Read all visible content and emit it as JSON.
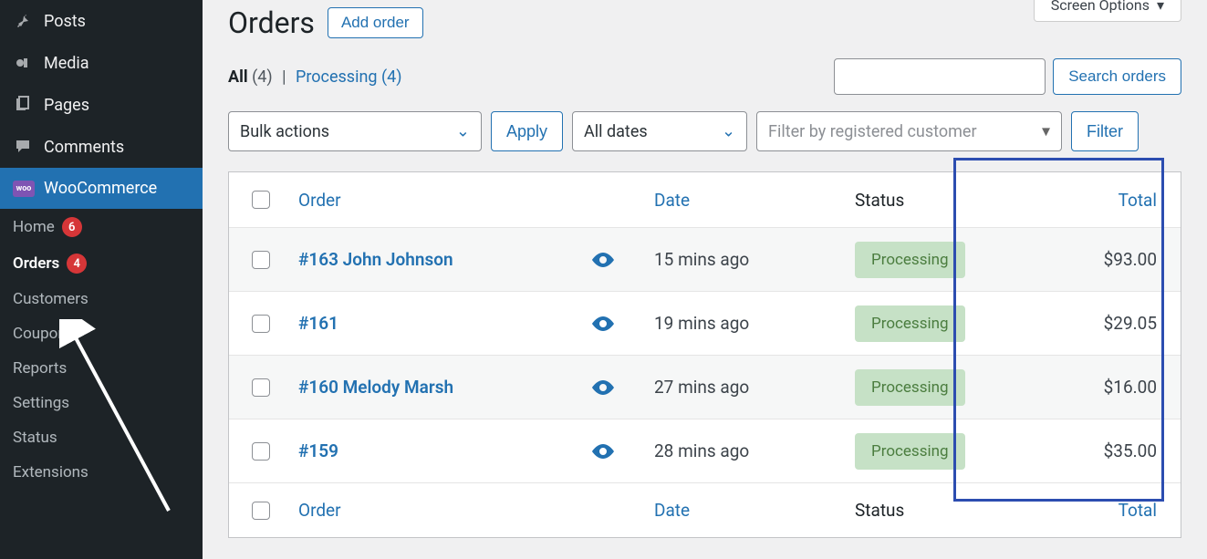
{
  "screen_options_label": "Screen Options",
  "sidebar": {
    "items": [
      {
        "label": "Posts"
      },
      {
        "label": "Media"
      },
      {
        "label": "Pages"
      },
      {
        "label": "Comments"
      },
      {
        "label": "WooCommerce"
      }
    ],
    "subs": [
      {
        "label": "Home",
        "badge": "6"
      },
      {
        "label": "Orders",
        "badge": "4"
      },
      {
        "label": "Customers"
      },
      {
        "label": "Coupons"
      },
      {
        "label": "Reports"
      },
      {
        "label": "Settings"
      },
      {
        "label": "Status"
      },
      {
        "label": "Extensions"
      }
    ]
  },
  "header": {
    "title": "Orders",
    "add_order_label": "Add order"
  },
  "subsub": {
    "all_label": "All",
    "all_count": "(4)",
    "sep": "|",
    "processing_label": "Processing",
    "processing_count": "(4)"
  },
  "search": {
    "button_label": "Search orders"
  },
  "filters": {
    "bulk_label": "Bulk actions",
    "apply_label": "Apply",
    "dates_label": "All dates",
    "customer_placeholder": "Filter by registered customer",
    "filter_label": "Filter"
  },
  "table": {
    "columns": {
      "order": "Order",
      "date": "Date",
      "status": "Status",
      "total": "Total"
    },
    "rows": [
      {
        "order": "#163 John Johnson",
        "date": "15 mins ago",
        "status": "Processing",
        "total": "$93.00"
      },
      {
        "order": "#161",
        "date": "19 mins ago",
        "status": "Processing",
        "total": "$29.05"
      },
      {
        "order": "#160 Melody Marsh",
        "date": "27 mins ago",
        "status": "Processing",
        "total": "$16.00"
      },
      {
        "order": "#159",
        "date": "28 mins ago",
        "status": "Processing",
        "total": "$35.00"
      }
    ]
  }
}
